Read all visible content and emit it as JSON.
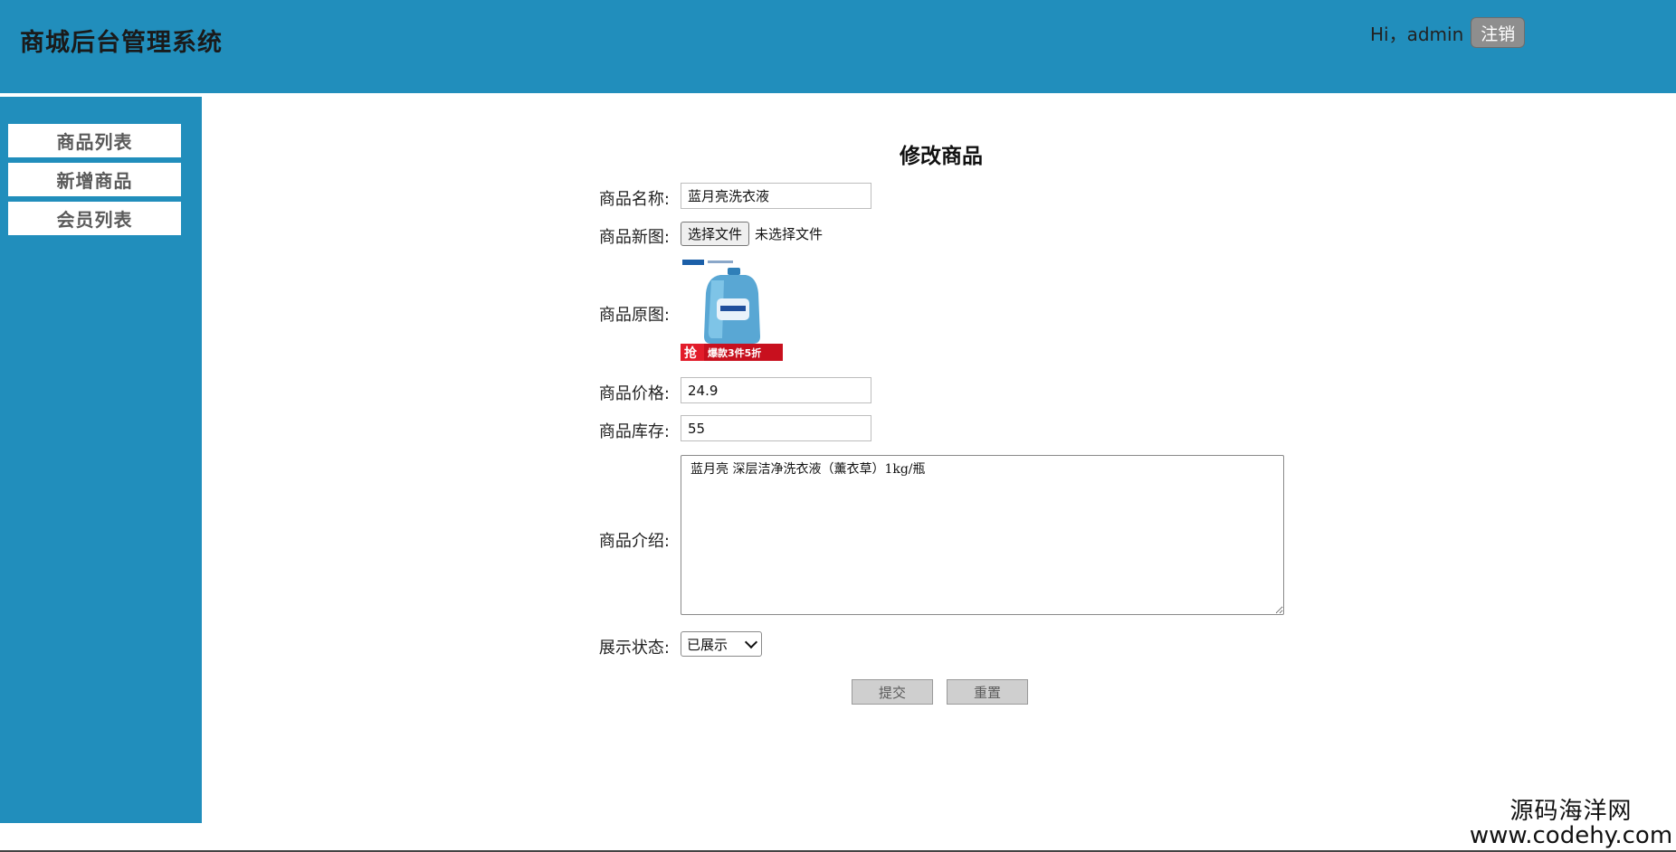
{
  "header": {
    "title": "商城后台管理系统",
    "greeting": "Hi，admin",
    "logout_label": "注销"
  },
  "sidebar": {
    "items": [
      {
        "label": "商品列表"
      },
      {
        "label": "新增商品"
      },
      {
        "label": "会员列表"
      }
    ]
  },
  "form": {
    "title": "修改商品",
    "name_label": "商品名称:",
    "name_value": "蓝月亮洗衣液",
    "new_image_label": "商品新图:",
    "file_button_label": "选择文件",
    "file_status": "未选择文件",
    "original_image_label": "商品原图:",
    "original_image_badge": "抢",
    "original_image_promo": "爆款3件5折",
    "price_label": "商品价格:",
    "price_value": "24.9",
    "stock_label": "商品库存:",
    "stock_value": "55",
    "description_label": "商品介绍:",
    "description_value": "蓝月亮 深层洁净洗衣液（薰衣草）1kg/瓶",
    "status_label": "展示状态:",
    "status_selected": "已展示",
    "submit_label": "提交",
    "reset_label": "重置"
  },
  "watermark": {
    "name": "源码海洋网",
    "url": "www.codehy.com"
  },
  "colors": {
    "primary": "#218ebc",
    "sidebar_item_bg": "#ffffff",
    "button_bg": "#cfcfcf"
  }
}
